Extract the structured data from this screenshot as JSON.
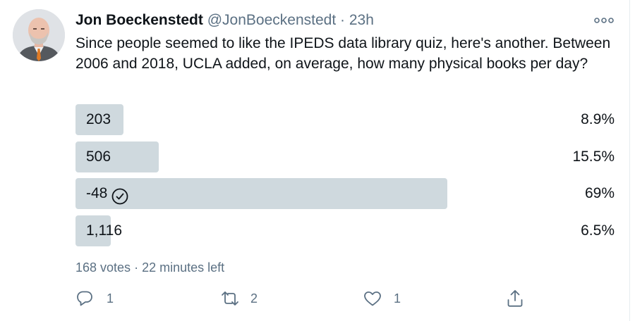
{
  "tweet": {
    "author_name": "Jon Boeckenstedt",
    "handle": "@JonBoeckenstedt",
    "separator": "·",
    "time": "23h",
    "text": "Since people seemed to like the IPEDS data library quiz, here's another. Between 2006 and 2018, UCLA added, on average, how many physical books per day?"
  },
  "poll": {
    "choices": [
      {
        "label": "203",
        "percent": "8.9%",
        "share": 8.9,
        "selected": false
      },
      {
        "label": "506",
        "percent": "15.5%",
        "share": 15.5,
        "selected": false
      },
      {
        "label": "-48",
        "percent": "69%",
        "share": 69,
        "selected": true
      },
      {
        "label": "1,116",
        "percent": "6.5%",
        "share": 6.5,
        "selected": false
      }
    ],
    "votes": "168 votes",
    "meta_separator": "·",
    "time_left": "22 minutes left"
  },
  "actions": {
    "reply_count": "1",
    "retweet_count": "2",
    "like_count": "1"
  },
  "colors": {
    "bar": "#cfd9de",
    "secondary_text": "#5b7083",
    "primary_text": "#0f1419"
  },
  "icons": [
    "more-icon",
    "check-circle-icon",
    "reply-icon",
    "retweet-icon",
    "like-icon",
    "share-icon"
  ]
}
